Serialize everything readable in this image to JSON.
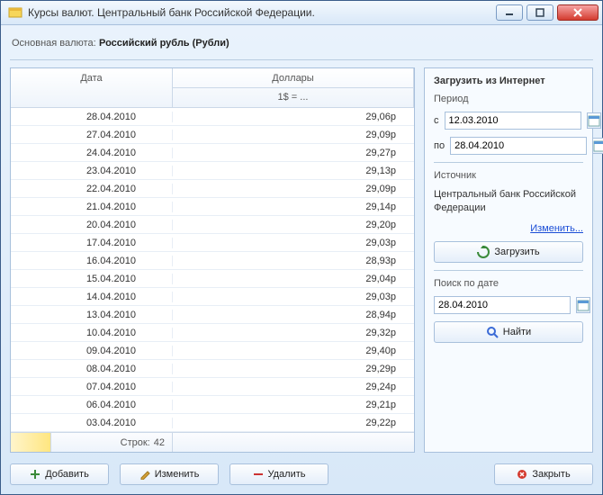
{
  "window": {
    "title": "Курсы валют. Центральный банк Российской Федерации."
  },
  "header": {
    "label": "Основная валюта:",
    "value": "Российский рубль (Рубли)"
  },
  "table": {
    "col_date": "Дата",
    "col_dollars": "Доллары",
    "col_sub": "1$ = ...",
    "rows": [
      {
        "date": "28.04.2010",
        "val": "29,06р"
      },
      {
        "date": "27.04.2010",
        "val": "29,09р"
      },
      {
        "date": "24.04.2010",
        "val": "29,27р"
      },
      {
        "date": "23.04.2010",
        "val": "29,13р"
      },
      {
        "date": "22.04.2010",
        "val": "29,09р"
      },
      {
        "date": "21.04.2010",
        "val": "29,14р"
      },
      {
        "date": "20.04.2010",
        "val": "29,20р"
      },
      {
        "date": "17.04.2010",
        "val": "29,03р"
      },
      {
        "date": "16.04.2010",
        "val": "28,93р"
      },
      {
        "date": "15.04.2010",
        "val": "29,04р"
      },
      {
        "date": "14.04.2010",
        "val": "29,03р"
      },
      {
        "date": "13.04.2010",
        "val": "28,94р"
      },
      {
        "date": "10.04.2010",
        "val": "29,32р"
      },
      {
        "date": "09.04.2010",
        "val": "29,40р"
      },
      {
        "date": "08.04.2010",
        "val": "29,29р"
      },
      {
        "date": "07.04.2010",
        "val": "29,24р"
      },
      {
        "date": "06.04.2010",
        "val": "29,21р"
      },
      {
        "date": "03.04.2010",
        "val": "29,22р"
      }
    ],
    "footer_label": "Строк:",
    "footer_count": "42"
  },
  "sidebar": {
    "load_title": "Загрузить из Интернет",
    "period": "Период",
    "from_label": "с",
    "to_label": "по",
    "from_value": "12.03.2010",
    "to_value": "28.04.2010",
    "source_label": "Источник",
    "source_text": "Центральный банк Российской Федерации",
    "change_link": "Изменить...",
    "load_btn": "Загрузить",
    "search_title": "Поиск по дате",
    "search_value": "28.04.2010",
    "find_btn": "Найти"
  },
  "buttons": {
    "add": "Добавить",
    "edit": "Изменить",
    "delete": "Удалить",
    "close": "Закрыть"
  }
}
